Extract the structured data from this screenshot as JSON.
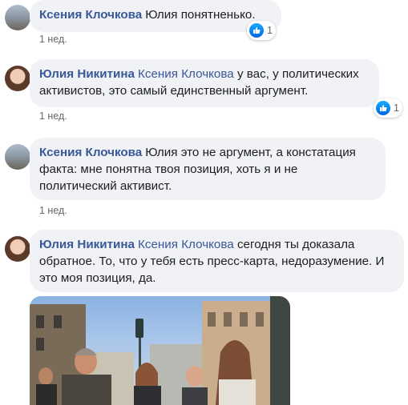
{
  "comments": [
    {
      "author": "Ксения Клочкова",
      "mention": "",
      "text": "Юлия понятненько.",
      "time": "1 нед.",
      "reactions": "1"
    },
    {
      "author": "Юлия Никитина",
      "mention": "Ксения Клочкова",
      "text": "у вас, у политических активистов, это самый единственный аргумент.",
      "time": "1 нед.",
      "reactions": "1"
    },
    {
      "author": "Ксения Клочкова",
      "mention": "",
      "text": "Юлия это не аргумент, а констатация факта: мне понятна твоя позиция, хоть я и не политический активист.",
      "time": "1 нед.",
      "reactions": ""
    },
    {
      "author": "Юлия Никитина",
      "mention": "Ксения Клочкова",
      "text": "сегодня ты доказала обратное. То, что у тебя есть пресс-карта, недоразумение. И это моя позиция, да.",
      "time": "",
      "reactions": ""
    }
  ],
  "colors": {
    "author_link": "#385898",
    "bubble_bg": "#f0f2f5",
    "like_blue": "#1877f2",
    "meta_gray": "#65676b"
  },
  "icons": [
    "avatar-ksenia",
    "avatar-yulia",
    "like-icon",
    "attached-photo"
  ]
}
